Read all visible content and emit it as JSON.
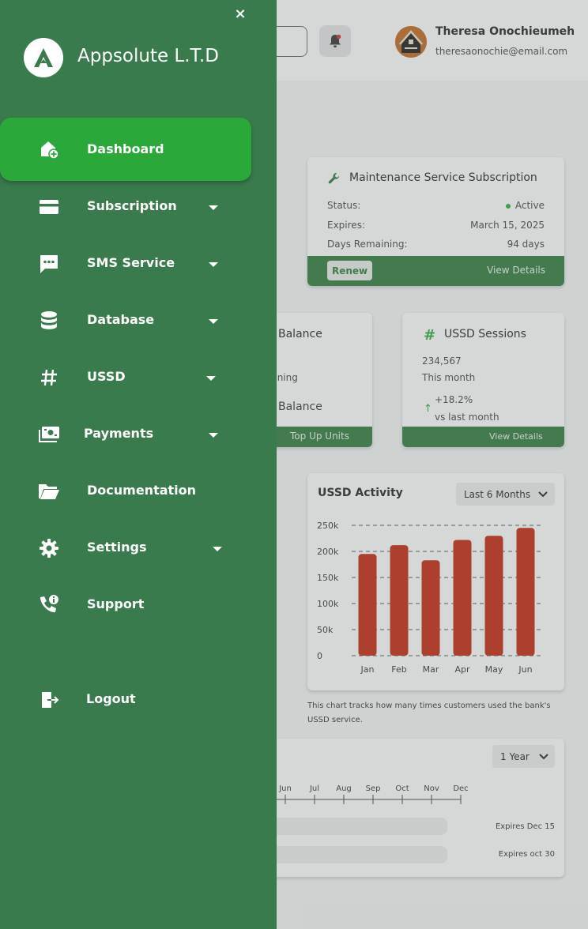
{
  "colors": {
    "sidebar": "#3a7b4e",
    "active_item": "#2aa83a",
    "card_bar": "#2f7a3a",
    "bar_fill": "#c4240c"
  },
  "user": {
    "name": "Theresa Onochieumeh",
    "email": "theresaonochie@email.com"
  },
  "header": {
    "icons": [
      "bell-icon",
      "avatar"
    ]
  },
  "sidebar": {
    "brand": "Appsolute L.T.D",
    "close_icon": "×",
    "items": [
      {
        "label": "Dashboard",
        "icon": "home-plus-icon",
        "active": true,
        "has_submenu": false
      },
      {
        "label": "Subscription",
        "icon": "credit-card-icon",
        "active": false,
        "has_submenu": true
      },
      {
        "label": "SMS Service",
        "icon": "chat-icon",
        "active": false,
        "has_submenu": true
      },
      {
        "label": "Database",
        "icon": "database-icon",
        "active": false,
        "has_submenu": true
      },
      {
        "label": "USSD",
        "icon": "hash-icon",
        "active": false,
        "has_submenu": true
      },
      {
        "label": "Payments",
        "icon": "money-icon",
        "active": false,
        "has_submenu": true
      },
      {
        "label": "Documentation",
        "icon": "folder-icon",
        "active": false,
        "has_submenu": false
      },
      {
        "label": "Settings",
        "icon": "gear-icon",
        "active": false,
        "has_submenu": true
      },
      {
        "label": "Support",
        "icon": "phone-info-icon",
        "active": false,
        "has_submenu": false
      }
    ],
    "logout": "Logout"
  },
  "maintenance": {
    "title": "Maintenance Service Subscription",
    "rows": [
      {
        "label": "Status:",
        "value": "Active"
      },
      {
        "label": "Expires:",
        "value": "March 15, 2025"
      },
      {
        "label": "Days Remaining:",
        "value": "94 days"
      }
    ],
    "renew": "Renew",
    "details": "View Details"
  },
  "balance": {
    "title": "Balance",
    "remaining": "aining",
    "label": "Balance",
    "topup": "Top Up Units"
  },
  "ussd_sessions": {
    "hash": "#",
    "title": "USSD Sessions",
    "count": "234,567",
    "period": "This month",
    "arrow": "↑",
    "change": "+18.2%",
    "compare": "vs last month",
    "details": "View Details"
  },
  "activity": {
    "title": "USSD Activity",
    "range": "Last 6 Months",
    "note": "This chart tracks how many times customers used the bank's USSD service."
  },
  "chart_data": {
    "type": "bar",
    "title": "USSD Activity",
    "categories": [
      "Jan",
      "Feb",
      "Mar",
      "Apr",
      "May",
      "Jun"
    ],
    "values": [
      195000,
      212000,
      183000,
      222000,
      230000,
      245000
    ],
    "ylim": [
      0,
      250000
    ],
    "yticks": [
      "250k",
      "200k",
      "150k",
      "100k",
      "50k",
      "0"
    ],
    "grid": true,
    "xlabel": "",
    "ylabel": ""
  },
  "timeline": {
    "range": "1 Year",
    "months": [
      "Jun",
      "Jul",
      "Aug",
      "Sep",
      "Oct",
      "Nov",
      "Dec"
    ],
    "bar1_progress": 0.13,
    "expiry_1": "Expires Dec 15",
    "expiry_2": "Expires oct 30"
  }
}
